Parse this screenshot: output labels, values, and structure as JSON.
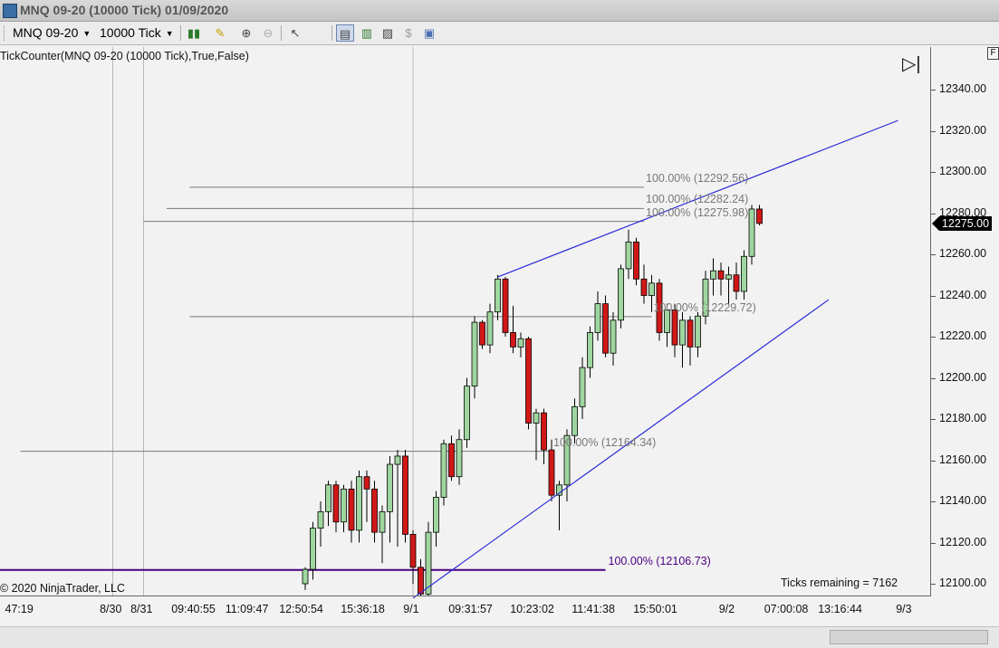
{
  "window": {
    "title": "MNQ 09-20 (10000 Tick)  01/09/2020"
  },
  "toolbar": {
    "instrument": "MNQ 09-20",
    "interval": "10000 Tick"
  },
  "indicator_label": "TickCounter(MNQ  09-20  (10000  Tick),True,False)",
  "copyright": "© 2020 NinjaTrader, LLC",
  "ticks_remaining": "Ticks remaining = 7162",
  "colors": {
    "up": "#9fd69f",
    "down": "#d01818",
    "wick": "#000000",
    "fib": "#787878",
    "trend": "#2a2ad8",
    "key_level": "#4b0082"
  },
  "chart_data": {
    "type": "candlestick",
    "price_axis": {
      "ylim": [
        12096,
        12362
      ],
      "ticks": [
        "12340.00",
        "12320.00",
        "12300.00",
        "12280.00",
        "12260.00",
        "12240.00",
        "12220.00",
        "12200.00",
        "12180.00",
        "12160.00",
        "12140.00",
        "12120.00",
        "12100.00"
      ],
      "last_price": "12275.00"
    },
    "time_axis": {
      "labels": [
        "47:19",
        "8/30",
        "8/31",
        "09:40:55",
        "11:09:47",
        "12:50:54",
        "15:36:18",
        "9/1",
        "09:31:57",
        "10:23:02",
        "11:41:38",
        "15:50:01",
        "9/2",
        "07:00:08",
        "13:16:44",
        "9/3"
      ],
      "slots": [
        1,
        15,
        19,
        26,
        33,
        40,
        48,
        54,
        62,
        70,
        78,
        86,
        95,
        103,
        110,
        118
      ],
      "day_separators": [
        15,
        19,
        54
      ]
    },
    "candles": [
      {
        "slot": 40,
        "o": 12100,
        "h": 12108,
        "l": 12097,
        "c": 12107
      },
      {
        "slot": 41,
        "o": 12107,
        "h": 12130,
        "l": 12102,
        "c": 12127
      },
      {
        "slot": 42,
        "o": 12127,
        "h": 12140,
        "l": 12118,
        "c": 12135
      },
      {
        "slot": 43,
        "o": 12135,
        "h": 12150,
        "l": 12128,
        "c": 12148
      },
      {
        "slot": 44,
        "o": 12148,
        "h": 12150,
        "l": 12125,
        "c": 12130
      },
      {
        "slot": 45,
        "o": 12130,
        "h": 12148,
        "l": 12125,
        "c": 12146
      },
      {
        "slot": 46,
        "o": 12146,
        "h": 12150,
        "l": 12120,
        "c": 12126
      },
      {
        "slot": 47,
        "o": 12126,
        "h": 12155,
        "l": 12120,
        "c": 12152
      },
      {
        "slot": 48,
        "o": 12152,
        "h": 12155,
        "l": 12130,
        "c": 12146
      },
      {
        "slot": 49,
        "o": 12146,
        "h": 12150,
        "l": 12120,
        "c": 12125
      },
      {
        "slot": 50,
        "o": 12125,
        "h": 12138,
        "l": 12110,
        "c": 12135
      },
      {
        "slot": 51,
        "o": 12135,
        "h": 12162,
        "l": 12120,
        "c": 12158
      },
      {
        "slot": 52,
        "o": 12158,
        "h": 12165,
        "l": 12118,
        "c": 12162
      },
      {
        "slot": 53,
        "o": 12162,
        "h": 12165,
        "l": 12120,
        "c": 12124
      },
      {
        "slot": 54,
        "o": 12124,
        "h": 12126,
        "l": 12100,
        "c": 12108
      },
      {
        "slot": 55,
        "o": 12108,
        "h": 12112,
        "l": 12090,
        "c": 12095
      },
      {
        "slot": 56,
        "o": 12095,
        "h": 12130,
        "l": 12090,
        "c": 12125
      },
      {
        "slot": 57,
        "o": 12125,
        "h": 12145,
        "l": 12118,
        "c": 12142
      },
      {
        "slot": 58,
        "o": 12142,
        "h": 12170,
        "l": 12138,
        "c": 12168
      },
      {
        "slot": 59,
        "o": 12168,
        "h": 12172,
        "l": 12150,
        "c": 12152
      },
      {
        "slot": 60,
        "o": 12152,
        "h": 12175,
        "l": 12148,
        "c": 12170
      },
      {
        "slot": 61,
        "o": 12170,
        "h": 12200,
        "l": 12166,
        "c": 12196
      },
      {
        "slot": 62,
        "o": 12196,
        "h": 12230,
        "l": 12190,
        "c": 12227
      },
      {
        "slot": 63,
        "o": 12227,
        "h": 12228,
        "l": 12214,
        "c": 12216
      },
      {
        "slot": 64,
        "o": 12216,
        "h": 12236,
        "l": 12212,
        "c": 12232
      },
      {
        "slot": 65,
        "o": 12232,
        "h": 12250,
        "l": 12228,
        "c": 12248
      },
      {
        "slot": 66,
        "o": 12248,
        "h": 12249,
        "l": 12220,
        "c": 12222
      },
      {
        "slot": 67,
        "o": 12222,
        "h": 12235,
        "l": 12212,
        "c": 12215
      },
      {
        "slot": 68,
        "o": 12215,
        "h": 12222,
        "l": 12210,
        "c": 12219
      },
      {
        "slot": 69,
        "o": 12219,
        "h": 12220,
        "l": 12175,
        "c": 12178
      },
      {
        "slot": 70,
        "o": 12178,
        "h": 12185,
        "l": 12160,
        "c": 12183
      },
      {
        "slot": 71,
        "o": 12183,
        "h": 12185,
        "l": 12158,
        "c": 12165
      },
      {
        "slot": 72,
        "o": 12165,
        "h": 12170,
        "l": 12140,
        "c": 12143
      },
      {
        "slot": 73,
        "o": 12143,
        "h": 12150,
        "l": 12126,
        "c": 12148
      },
      {
        "slot": 74,
        "o": 12148,
        "h": 12175,
        "l": 12140,
        "c": 12172
      },
      {
        "slot": 75,
        "o": 12172,
        "h": 12190,
        "l": 12168,
        "c": 12186
      },
      {
        "slot": 76,
        "o": 12186,
        "h": 12210,
        "l": 12180,
        "c": 12205
      },
      {
        "slot": 77,
        "o": 12205,
        "h": 12225,
        "l": 12200,
        "c": 12222
      },
      {
        "slot": 78,
        "o": 12222,
        "h": 12242,
        "l": 12218,
        "c": 12236
      },
      {
        "slot": 79,
        "o": 12236,
        "h": 12240,
        "l": 12210,
        "c": 12212
      },
      {
        "slot": 80,
        "o": 12212,
        "h": 12232,
        "l": 12206,
        "c": 12228
      },
      {
        "slot": 81,
        "o": 12228,
        "h": 12255,
        "l": 12224,
        "c": 12253
      },
      {
        "slot": 82,
        "o": 12253,
        "h": 12272,
        "l": 12248,
        "c": 12266
      },
      {
        "slot": 83,
        "o": 12266,
        "h": 12268,
        "l": 12245,
        "c": 12248
      },
      {
        "slot": 84,
        "o": 12248,
        "h": 12255,
        "l": 12236,
        "c": 12240
      },
      {
        "slot": 85,
        "o": 12240,
        "h": 12250,
        "l": 12232,
        "c": 12246
      },
      {
        "slot": 86,
        "o": 12246,
        "h": 12248,
        "l": 12218,
        "c": 12222
      },
      {
        "slot": 87,
        "o": 12222,
        "h": 12236,
        "l": 12215,
        "c": 12233
      },
      {
        "slot": 88,
        "o": 12233,
        "h": 12236,
        "l": 12210,
        "c": 12216
      },
      {
        "slot": 89,
        "o": 12216,
        "h": 12232,
        "l": 12205,
        "c": 12228
      },
      {
        "slot": 90,
        "o": 12228,
        "h": 12230,
        "l": 12206,
        "c": 12215
      },
      {
        "slot": 91,
        "o": 12215,
        "h": 12232,
        "l": 12210,
        "c": 12230
      },
      {
        "slot": 92,
        "o": 12230,
        "h": 12252,
        "l": 12226,
        "c": 12248
      },
      {
        "slot": 93,
        "o": 12248,
        "h": 12258,
        "l": 12240,
        "c": 12252
      },
      {
        "slot": 94,
        "o": 12252,
        "h": 12256,
        "l": 12240,
        "c": 12248
      },
      {
        "slot": 95,
        "o": 12248,
        "h": 12254,
        "l": 12236,
        "c": 12250
      },
      {
        "slot": 96,
        "o": 12250,
        "h": 12256,
        "l": 12238,
        "c": 12242
      },
      {
        "slot": 97,
        "o": 12242,
        "h": 12262,
        "l": 12238,
        "c": 12259
      },
      {
        "slot": 98,
        "o": 12259,
        "h": 12284,
        "l": 12255,
        "c": 12282
      },
      {
        "slot": 99,
        "o": 12282,
        "h": 12284,
        "l": 12274,
        "c": 12275
      }
    ],
    "fib_levels": [
      {
        "label": "100.00% (12292.56)",
        "price": 12292.56,
        "from_slot": 25,
        "to_slot": 84
      },
      {
        "label": "100.00% (12282.24)",
        "price": 12282.24,
        "from_slot": 22,
        "to_slot": 84
      },
      {
        "label": "100.00% (12275.98)",
        "price": 12275.98,
        "from_slot": 19,
        "to_slot": 84
      },
      {
        "label": "100.00% (12229.72)",
        "price": 12229.72,
        "from_slot": 25,
        "to_slot": 85
      },
      {
        "label": "100.00% (12164.34)",
        "price": 12164.34,
        "from_slot": 3,
        "to_slot": 72
      }
    ],
    "key_level": {
      "label": "100.00% (12106.73)",
      "price": 12106.73
    },
    "trend_lines": [
      {
        "from": {
          "slot": 65,
          "price": 12249
        },
        "to": {
          "slot": 117,
          "price": 12325
        }
      },
      {
        "from": {
          "slot": 54,
          "price": 12093
        },
        "to": {
          "slot": 108,
          "price": 12238
        }
      }
    ]
  }
}
